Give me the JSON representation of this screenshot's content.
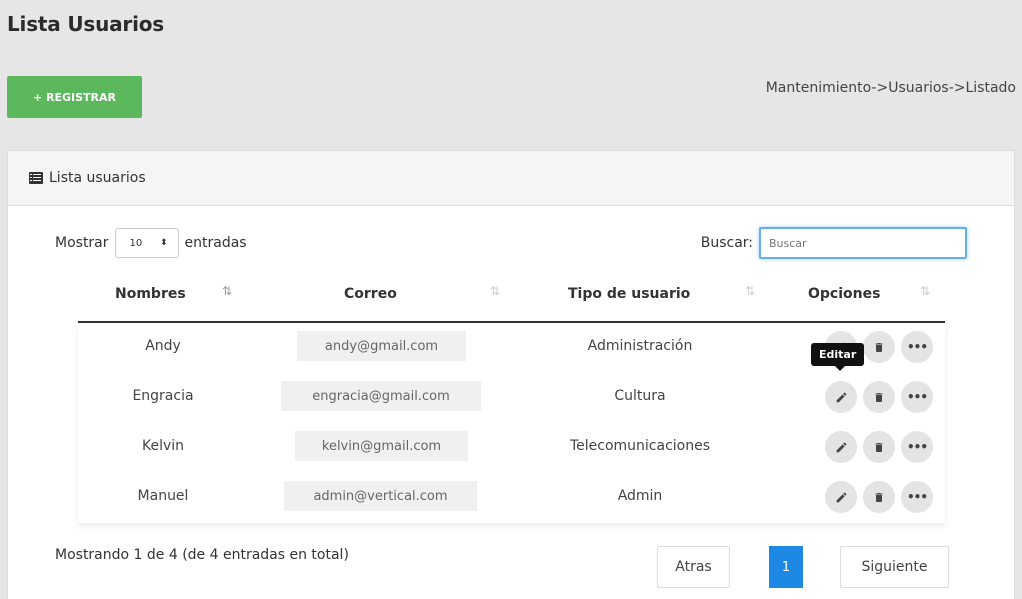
{
  "page": {
    "title": "Lista Usuarios"
  },
  "toolbar": {
    "register_label": "+ REGISTRAR"
  },
  "breadcrumb": "Mantenimiento->Usuarios->Listado",
  "panel": {
    "heading": "Lista usuarios"
  },
  "length": {
    "prefix": "Mostrar",
    "value": "10",
    "suffix": "entradas"
  },
  "search": {
    "label": "Buscar:",
    "placeholder": "Buscar"
  },
  "columns": [
    "Nombres",
    "Correo",
    "Tipo de usuario",
    "Opciones"
  ],
  "rows": [
    {
      "nombre": "Andy",
      "correo": "andy@gmail.com",
      "tipo": "Administración"
    },
    {
      "nombre": "Engracia",
      "correo": "engracia@gmail.com",
      "tipo": "Cultura"
    },
    {
      "nombre": "Kelvin",
      "correo": "kelvin@gmail.com",
      "tipo": "Telecomunicaciones"
    },
    {
      "nombre": "Manuel",
      "correo": "admin@vertical.com",
      "tipo": "Admin"
    }
  ],
  "tooltip": "Editar",
  "footer": {
    "info": "Mostrando 1 de 4 (de 4 entradas en total)"
  },
  "pagination": {
    "prev": "Atras",
    "current": "1",
    "next": "Siguiente"
  },
  "icons": {
    "edit": "pencil-icon",
    "delete": "trash-icon",
    "more": "ellipsis-icon",
    "list": "list-icon",
    "sort": "sort-icon"
  },
  "colors": {
    "register": "#5cb85c",
    "page_active": "#1e88e5",
    "search_focus": "#66afe9"
  }
}
